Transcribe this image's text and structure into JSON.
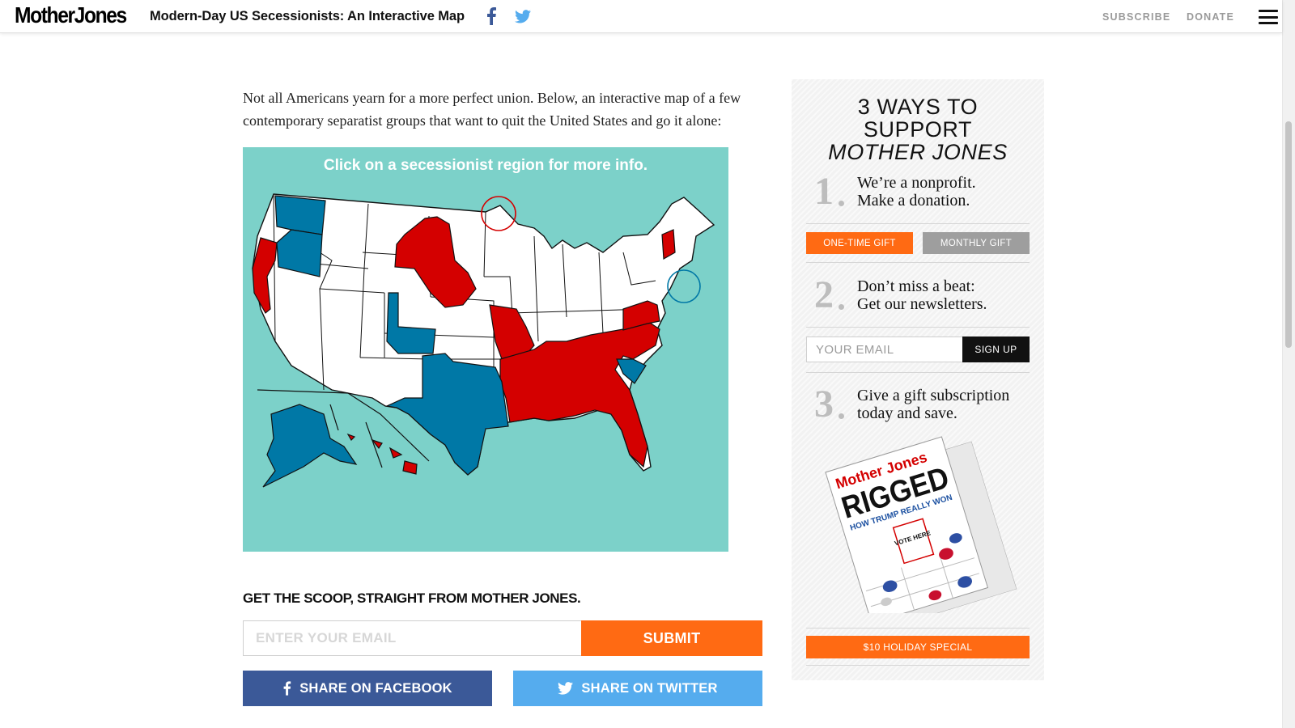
{
  "header": {
    "logo": "MotherJones",
    "article_title": "Modern-Day US Secessionists: An Interactive Map",
    "nav": {
      "subscribe": "SUBSCRIBE",
      "donate": "DONATE"
    },
    "icons": [
      "facebook-icon",
      "twitter-icon",
      "menu-icon"
    ]
  },
  "article": {
    "intro_line1": "Not all Americans yearn for a more perfect union. Below, an interactive map of a few",
    "intro_line2": "contemporary separatist groups that want to quit the United States and go it alone:",
    "map": {
      "caption": "Click on a secessionist region for more info.",
      "colors": {
        "background": "#7cd1c9",
        "red": "#d40000",
        "blue": "#0078a6",
        "white": "#ffffff"
      },
      "red_regions": [
        "Oregon coast / Northern California",
        "Northern Plains (Lakota)",
        "Missouri",
        "Southeast (Arkansas to Florida, Virginia, North Carolina)",
        "Vermont",
        "Hawaii"
      ],
      "blue_regions": [
        "Washington",
        "Oregon",
        "Colorado corridor",
        "Texas",
        "South Carolina",
        "Alaska"
      ],
      "highlight_circles": [
        "north-central border",
        "New York City"
      ]
    }
  },
  "newsletter": {
    "heading": "GET THE SCOOP, STRAIGHT FROM MOTHER JONES.",
    "email_placeholder": "ENTER YOUR EMAIL",
    "submit_label": "SUBMIT"
  },
  "share": {
    "facebook_label": "SHARE ON FACEBOOK",
    "twitter_label": "SHARE ON TWITTER"
  },
  "sidebar": {
    "title_line1": "3 WAYS TO",
    "title_line2": "SUPPORT",
    "title_line3": "MOTHER JONES",
    "step1": {
      "num": "1",
      "line1": "We’re a nonprofit.",
      "line2": "Make a donation."
    },
    "one_time_gift": "ONE-TIME GIFT",
    "monthly_gift": "MONTHLY GIFT",
    "step2": {
      "num": "2",
      "line1": "Don’t miss a beat:",
      "line2": "Get our newsletters."
    },
    "email_placeholder": "YOUR EMAIL",
    "signup_label": "SIGN UP",
    "step3": {
      "num": "3",
      "line1": "Give a gift subscription",
      "line2": "today and save."
    },
    "cover": {
      "brand": "Mother Jones",
      "headline": "RIGGED",
      "subhead": "HOW TRUMP REALLY WON",
      "sign": "VOTE HERE"
    },
    "holiday_label": "$10 HOLIDAY SPECIAL"
  }
}
